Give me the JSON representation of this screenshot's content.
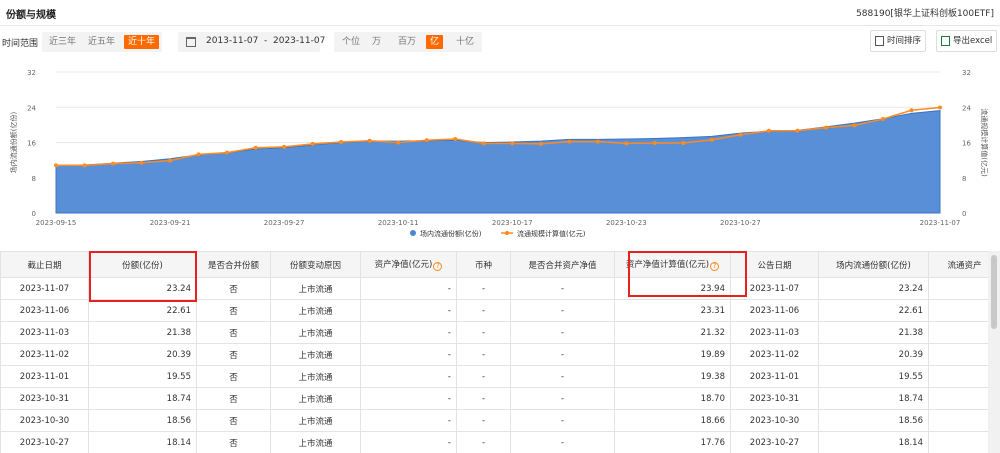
{
  "header": {
    "title": "份额与规模",
    "fund": "588190[银华上证科创板100ETF]"
  },
  "toolbar": {
    "range_label": "时间范围",
    "ranges": [
      "近三年",
      "近五年",
      "近十年"
    ],
    "active_range": 2,
    "date_range": "2013-11-07  -  2023-11-07",
    "units": [
      "个位",
      "万",
      "百万",
      "亿",
      "十亿"
    ],
    "active_unit": 3,
    "sort_label": "时间排序",
    "export_label": "导出excel"
  },
  "chart_data": {
    "type": "area",
    "x": [
      "2023-09-15",
      "2023-09-18",
      "2023-09-19",
      "2023-09-20",
      "2023-09-21",
      "2023-09-22",
      "2023-09-25",
      "2023-09-26",
      "2023-09-27",
      "2023-09-28",
      "2023-10-09",
      "2023-10-10",
      "2023-10-11",
      "2023-10-12",
      "2023-10-13",
      "2023-10-16",
      "2023-10-17",
      "2023-10-18",
      "2023-10-19",
      "2023-10-20",
      "2023-10-23",
      "2023-10-24",
      "2023-10-25",
      "2023-10-26",
      "2023-10-27",
      "2023-10-30",
      "2023-10-31",
      "2023-11-01",
      "2023-11-02",
      "2023-11-03",
      "2023-11-06",
      "2023-11-07"
    ],
    "xticks": [
      "2023-09-15",
      "2023-09-21",
      "2023-09-27",
      "2023-10-11",
      "2023-10-17",
      "2023-10-23",
      "2023-10-27",
      "2023-11-07"
    ],
    "ylim": [
      0,
      32
    ],
    "yticks": [
      0,
      8,
      16,
      24,
      32
    ],
    "ylabel_left": "场内流通份额(亿份)",
    "ylabel_right": "流通规模计算值(亿元)",
    "series": [
      {
        "name": "场内流通份额(亿份)",
        "color": "#4a86d4",
        "values": [
          10.8,
          10.9,
          11.3,
          11.7,
          12.3,
          13.2,
          13.7,
          14.5,
          14.8,
          15.4,
          16.0,
          16.3,
          16.3,
          16.4,
          16.5,
          16.0,
          16.1,
          16.3,
          16.7,
          16.7,
          16.8,
          16.9,
          17.1,
          17.4,
          18.14,
          18.56,
          18.74,
          19.55,
          20.39,
          21.38,
          22.61,
          23.24
        ]
      },
      {
        "name": "流通规模计算值(亿元)",
        "color": "#ff8a1f",
        "values": [
          10.8,
          10.8,
          11.2,
          11.4,
          11.9,
          13.3,
          13.7,
          14.8,
          15.0,
          15.7,
          16.1,
          16.4,
          16.0,
          16.5,
          16.8,
          15.8,
          15.8,
          15.7,
          16.2,
          16.2,
          15.8,
          15.9,
          15.9,
          16.6,
          17.76,
          18.66,
          18.7,
          19.38,
          19.89,
          21.32,
          23.31,
          23.94
        ]
      }
    ]
  },
  "table": {
    "columns": [
      "截止日期",
      "份额(亿份)",
      "是否合并份额",
      "份额变动原因",
      "资产净值(亿元)",
      "币种",
      "是否合并资产净值",
      "资产净值计算值(亿元)",
      "公告日期",
      "场内流通份额(亿份)",
      "流通资产"
    ],
    "rows": [
      [
        "2023-11-07",
        "23.24",
        "否",
        "上市流通",
        "-",
        "-",
        "-",
        "23.94",
        "2023-11-07",
        "23.24"
      ],
      [
        "2023-11-06",
        "22.61",
        "否",
        "上市流通",
        "-",
        "-",
        "-",
        "23.31",
        "2023-11-06",
        "22.61"
      ],
      [
        "2023-11-03",
        "21.38",
        "否",
        "上市流通",
        "-",
        "-",
        "-",
        "21.32",
        "2023-11-03",
        "21.38"
      ],
      [
        "2023-11-02",
        "20.39",
        "否",
        "上市流通",
        "-",
        "-",
        "-",
        "19.89",
        "2023-11-02",
        "20.39"
      ],
      [
        "2023-11-01",
        "19.55",
        "否",
        "上市流通",
        "-",
        "-",
        "-",
        "19.38",
        "2023-11-01",
        "19.55"
      ],
      [
        "2023-10-31",
        "18.74",
        "否",
        "上市流通",
        "-",
        "-",
        "-",
        "18.70",
        "2023-10-31",
        "18.74"
      ],
      [
        "2023-10-30",
        "18.56",
        "否",
        "上市流通",
        "-",
        "-",
        "-",
        "18.66",
        "2023-10-30",
        "18.56"
      ],
      [
        "2023-10-27",
        "18.14",
        "否",
        "上市流通",
        "-",
        "-",
        "-",
        "17.76",
        "2023-10-27",
        "18.14"
      ]
    ]
  }
}
